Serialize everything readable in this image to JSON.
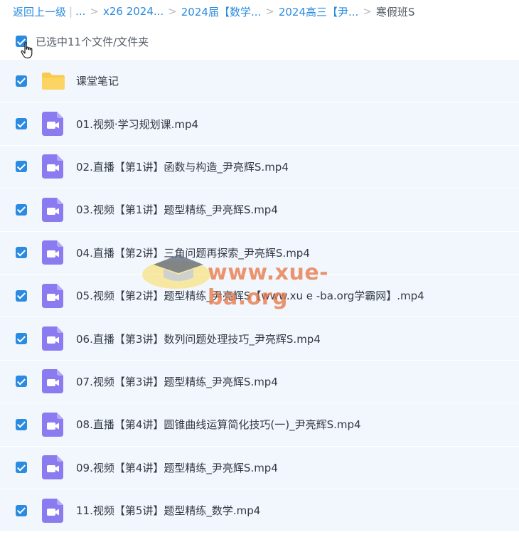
{
  "breadcrumb": {
    "back": "返回上一级",
    "ellipsis": "...",
    "items": [
      "x26 2024...",
      "2024届【数学...",
      "2024高三【尹...",
      "寒假班S"
    ]
  },
  "selection": {
    "text": "已选中11个文件/文件夹"
  },
  "files": [
    {
      "name": "课堂笔记",
      "type": "folder"
    },
    {
      "name": "01.视频·学习规划课.mp4",
      "type": "video"
    },
    {
      "name": "02.直播【第1讲】函数与构造_尹亮辉S.mp4",
      "type": "video"
    },
    {
      "name": "03.视频【第1讲】题型精练_尹亮辉S.mp4",
      "type": "video"
    },
    {
      "name": "04.直播【第2讲】三角问题再探索_尹亮辉S.mp4",
      "type": "video"
    },
    {
      "name": "05.视频【第2讲】题型精练_尹亮辉S【www.xu e -ba.org学霸网】.mp4",
      "type": "video"
    },
    {
      "name": "06.直播【第3讲】数列问题处理技巧_尹亮辉S.mp4",
      "type": "video"
    },
    {
      "name": "07.视频【第3讲】题型精练_尹亮辉S.mp4",
      "type": "video"
    },
    {
      "name": "08.直播【第4讲】圆锥曲线运算简化技巧(一)_尹亮辉S.mp4",
      "type": "video"
    },
    {
      "name": "09.视频【第4讲】题型精练_尹亮辉S.mp4",
      "type": "video"
    },
    {
      "name": "11.视频【第5讲】题型精练_数学.mp4",
      "type": "video"
    }
  ],
  "watermark": {
    "text": "www.xue-ba.org"
  },
  "colors": {
    "accent": "#2a8be0",
    "row_bg": "#f2f7fd",
    "folder": "#f9c94a",
    "video_icon": "#8a7cf0"
  }
}
